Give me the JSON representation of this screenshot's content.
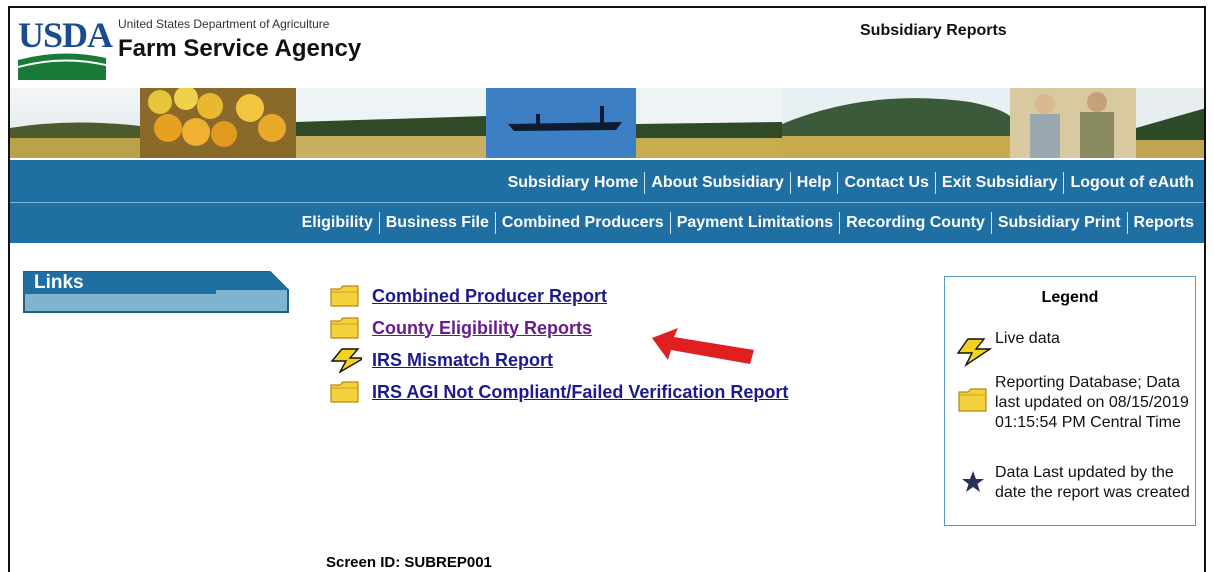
{
  "header": {
    "logo_text": "USDA",
    "department": "United States Department of Agriculture",
    "agency": "Farm Service Agency",
    "page_title": "Subsidiary Reports"
  },
  "nav": {
    "row1": [
      "Subsidiary Home",
      "About Subsidiary",
      "Help",
      "Contact Us",
      "Exit Subsidiary",
      "Logout of eAuth"
    ],
    "row2": [
      "Eligibility",
      "Business File",
      "Combined Producers",
      "Payment Limitations",
      "Recording County",
      "Subsidiary Print",
      "Reports"
    ]
  },
  "sidebar": {
    "links_label": "Links"
  },
  "reports": [
    {
      "label": "Combined Producer Report",
      "icon": "folder-icon"
    },
    {
      "label": "County Eligibility Reports",
      "icon": "folder-icon"
    },
    {
      "label": "IRS Mismatch Report",
      "icon": "lightning-icon"
    },
    {
      "label": "IRS AGI Not Compliant/Failed Verification Report",
      "icon": "folder-icon"
    }
  ],
  "legend": {
    "title": "Legend",
    "live": "Live data",
    "reporting": "Reporting Database; Data last updated on 08/15/2019 01:15:54 PM Central Time",
    "star": "Data Last updated by the date the report was created"
  },
  "footer": {
    "screen_id": "Screen ID: SUBREP001"
  },
  "colors": {
    "nav_blue": "#1f6fa3",
    "link": "#1b1b8f",
    "visited_link": "#6a1b8e",
    "arrow_red": "#e02020"
  }
}
